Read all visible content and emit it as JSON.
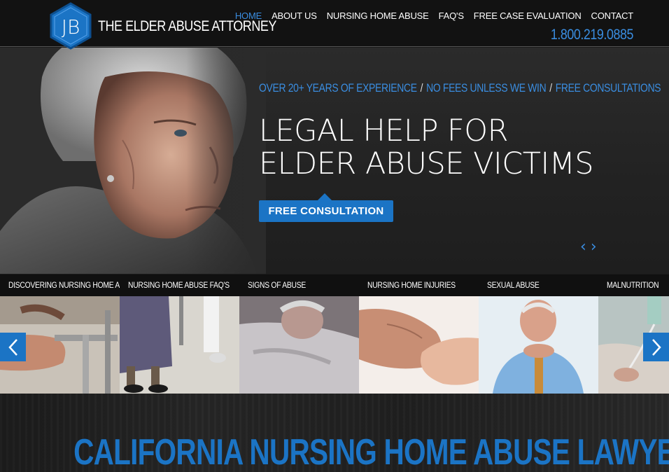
{
  "header": {
    "logo_icon": "jb-hexagon-logo",
    "brand_name": "THE ELDER ABUSE ATTORNEY",
    "phone": "1.800.219.0885",
    "nav": [
      {
        "label": "HOME",
        "active": true
      },
      {
        "label": "ABOUT US",
        "active": false
      },
      {
        "label": "NURSING HOME ABUSE",
        "active": false
      },
      {
        "label": "FAQ'S",
        "active": false
      },
      {
        "label": "FREE CASE EVALUATION",
        "active": false
      },
      {
        "label": "CONTACT",
        "active": false
      }
    ]
  },
  "hero": {
    "tagline": [
      "OVER 20+ YEARS OF EXPERIENCE",
      "NO FEES UNLESS WE WIN",
      "FREE CONSULTATIONS"
    ],
    "tagline_separator": "/",
    "headline_line1": "LEGAL HELP FOR",
    "headline_line2": "ELDER ABUSE VICTIMS",
    "cta_label": "FREE CONSULTATION",
    "prev_arrow": "‹",
    "next_arrow": "›"
  },
  "tiles": [
    {
      "label": "DISCOVERING NURSING HOME ABUSE"
    },
    {
      "label": "NURSING HOME ABUSE FAQ'S"
    },
    {
      "label": "SIGNS OF ABUSE"
    },
    {
      "label": "NURSING HOME INJURIES"
    },
    {
      "label": "SEXUAL ABUSE"
    },
    {
      "label": "MALNUTRITION"
    }
  ],
  "section": {
    "title": "CALIFORNIA NURSING HOME ABUSE LAWYER"
  },
  "colors": {
    "accent": "#1b74c5",
    "accent_light": "#3a8de0",
    "header_bg": "#121212"
  }
}
